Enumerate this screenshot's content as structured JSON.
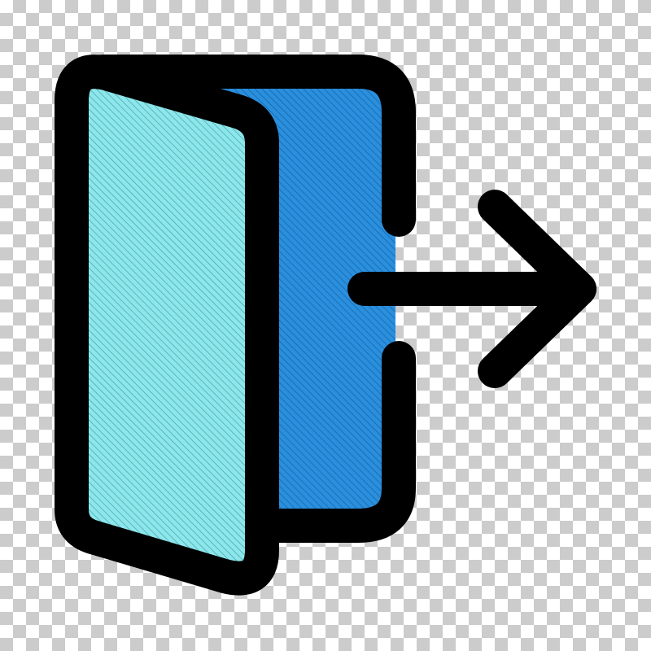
{
  "icon": {
    "name": "exit-door-icon",
    "colors": {
      "outline": "#000000",
      "door_panel": "#7fe3e6",
      "door_frame_fill": "#1e84d4",
      "checker_light": "#ffffff",
      "checker_dark": "#cccccc"
    }
  }
}
